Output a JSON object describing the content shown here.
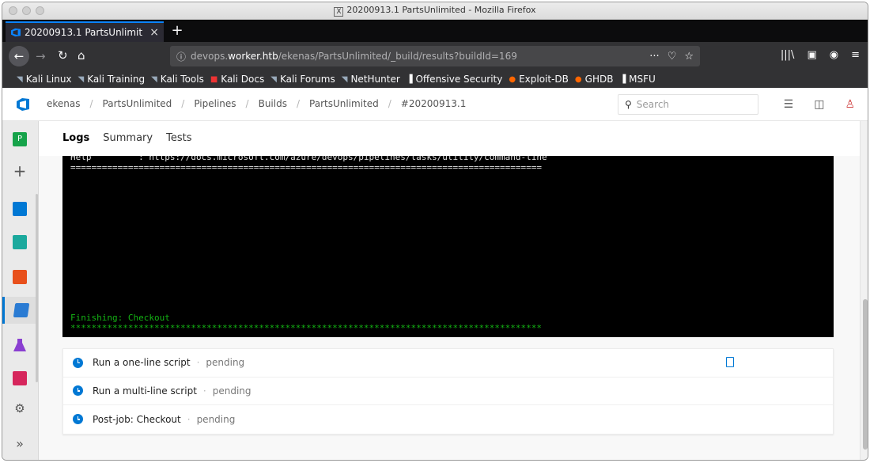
{
  "window": {
    "title": "20200913.1 PartsUnlimited - Mozilla Firefox"
  },
  "tab": {
    "label": "20200913.1 PartsUnlimit",
    "close": "×",
    "new_tab": "+"
  },
  "nav": {
    "url_prefix": "devops.",
    "url_domain": "worker.htb",
    "url_path": "/ekenas/PartsUnlimited/_build/results?buildId=169",
    "url_actions": [
      "···",
      "♡",
      "☆"
    ]
  },
  "bookmarks": [
    {
      "label": "Kali Linux",
      "icon": "dragon-icon",
      "color": "#9ab"
    },
    {
      "label": "Kali Training",
      "icon": "dragon-icon",
      "color": "#9ab"
    },
    {
      "label": "Kali Tools",
      "icon": "dragon-icon",
      "color": "#9ab"
    },
    {
      "label": "Kali Docs",
      "icon": "docs-icon",
      "color": "#e33"
    },
    {
      "label": "Kali Forums",
      "icon": "dragon-icon",
      "color": "#9ab"
    },
    {
      "label": "NetHunter",
      "icon": "dragon-icon",
      "color": "#9ab"
    },
    {
      "label": "Offensive Security",
      "icon": "offsec-icon",
      "color": "#fff"
    },
    {
      "label": "Exploit-DB",
      "icon": "bug-icon",
      "color": "#f60"
    },
    {
      "label": "GHDB",
      "icon": "bug-icon",
      "color": "#f60"
    },
    {
      "label": "MSFU",
      "icon": "offsec-icon",
      "color": "#fff"
    }
  ],
  "breadcrumbs": [
    "ekenas",
    "PartsUnlimited",
    "Pipelines",
    "Builds",
    "PartsUnlimited",
    "#20200913.1"
  ],
  "search": {
    "placeholder": "Search"
  },
  "rail": {
    "project_initial": "P",
    "project_color": "#16a34a"
  },
  "page_tabs": [
    "Logs",
    "Summary",
    "Tests"
  ],
  "console": {
    "lines": [
      {
        "text": "Help         : https://docs.microsoft.com/azure/devops/pipelines/tasks/utility/command-line",
        "green": false
      },
      {
        "text": "==========================================================================================",
        "green": false
      },
      {
        "text": "Finishing: Checkout",
        "green": true
      },
      {
        "text": "******************************************************************************************",
        "green": true
      }
    ]
  },
  "steps": [
    {
      "name": "Run a one-line script",
      "status": "pending"
    },
    {
      "name": "Run a multi-line script",
      "status": "pending"
    },
    {
      "name": "Post-job: Checkout",
      "status": "pending"
    }
  ],
  "colors": {
    "accent": "#0078d4",
    "console_bg": "#000000",
    "console_green": "#14b314"
  }
}
